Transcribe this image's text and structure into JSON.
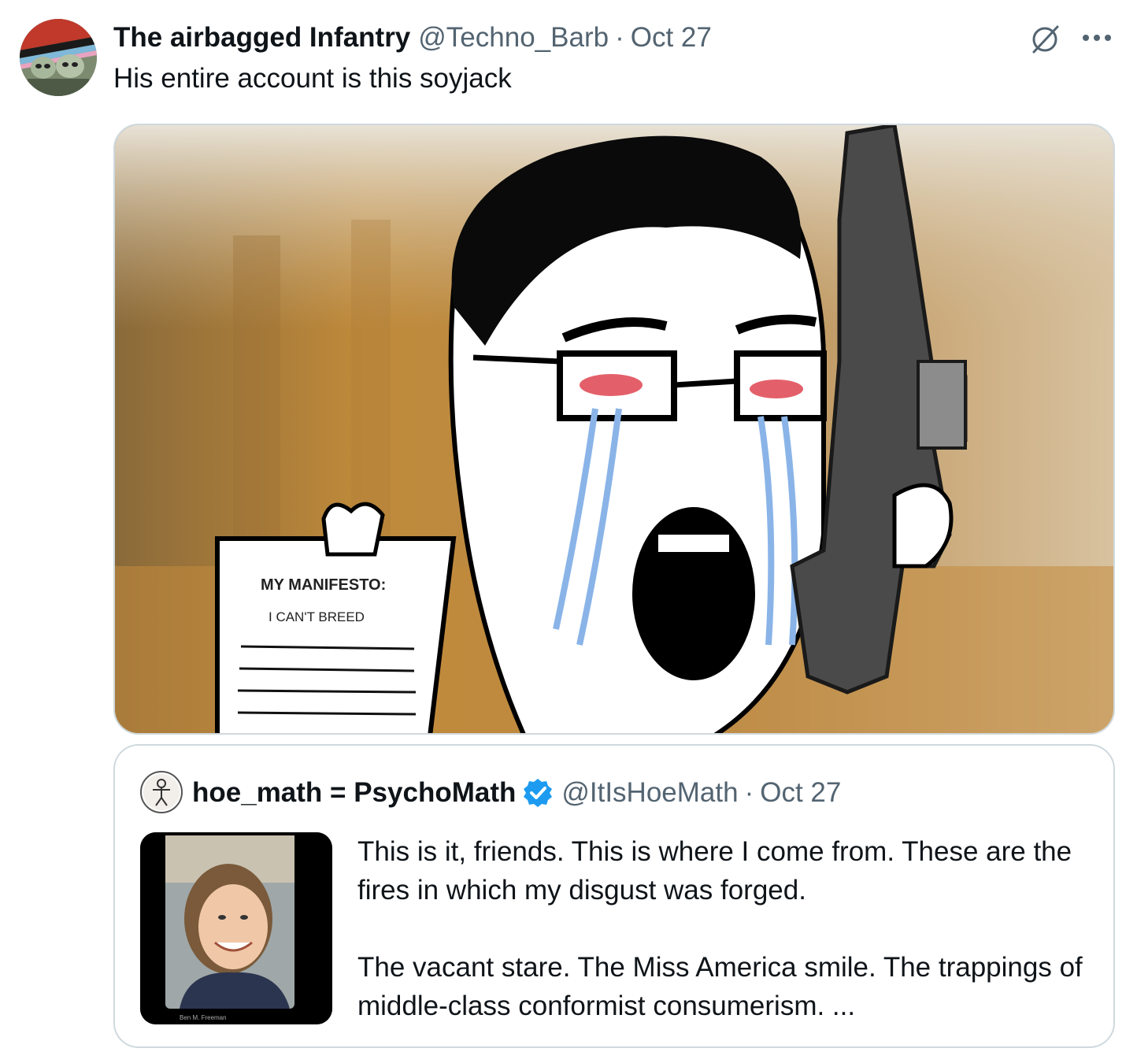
{
  "tweet": {
    "display_name": "The airbagged Infantry",
    "handle": "@Techno_Barb",
    "separator": "·",
    "date": "Oct 27",
    "text": "His entire account is this soyjack",
    "avatar_icon": "avatar-soldiers-icon",
    "action_icons": [
      "grok-icon",
      "more-icon"
    ]
  },
  "media": {
    "meme_lettering": [
      "MY MANIFESTO:",
      "I CAN'T BREED"
    ]
  },
  "quote": {
    "display_name": "hoe_math = PsychoMath",
    "verified": true,
    "handle": "@ItIsHoeMath",
    "separator": "·",
    "date": "Oct 27",
    "paragraph_1": "This is it, friends. This is where I come from. These are the fires in which my disgust was forged.",
    "paragraph_2": "The vacant stare. The Miss America smile. The trappings of middle-class conformist consumerism. ...",
    "thumbnail_caption": "Ben M. Freeman"
  },
  "colors": {
    "text_primary": "#0f1419",
    "text_secondary": "#536471",
    "border": "#cfd9de",
    "verified_blue": "#1d9bf0"
  }
}
